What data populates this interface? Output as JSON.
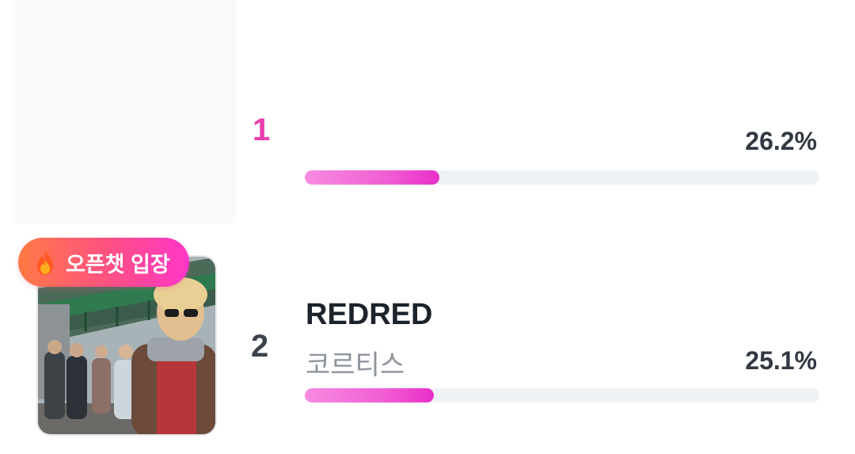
{
  "entries": [
    {
      "rank": "1",
      "title": "",
      "artist": "",
      "percent_label": "26.2%",
      "percent_value": 26.2
    },
    {
      "rank": "2",
      "title": "REDRED",
      "artist": "코르티스",
      "percent_label": "25.1%",
      "percent_value": 25.1,
      "badge_label": "오픈챗 입장",
      "badge_icon": "flame-icon"
    }
  ],
  "colors": {
    "accent_pink": "#ea3fae",
    "bar_track": "#eff2f5",
    "rank_dark": "#3c434c"
  }
}
